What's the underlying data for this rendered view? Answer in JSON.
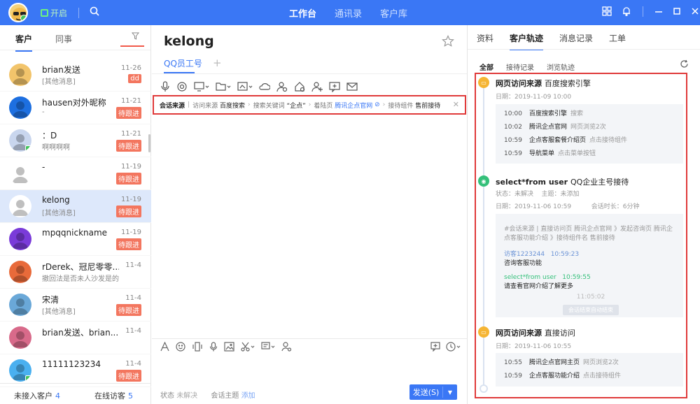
{
  "topbar": {
    "status_label": "开启",
    "tabs": [
      {
        "label": "工作台",
        "active": true
      },
      {
        "label": "通讯录",
        "active": false
      },
      {
        "label": "客户库",
        "active": false
      }
    ],
    "accent": "#3a77f5"
  },
  "left": {
    "tabs": [
      "客户",
      "同事"
    ],
    "contacts": [
      {
        "name": "brian发送",
        "sub": "[其他消息]",
        "date": "11-26",
        "tag": "dd",
        "avatar_color": "#f2c46b",
        "online": false
      },
      {
        "name": "hausen对外昵称",
        "sub": "-",
        "date": "11-21",
        "tag": "待跟进",
        "avatar_color": "#1d6fe0",
        "online": false
      },
      {
        "name": "：D",
        "sub": "啊啊啊啊",
        "date": "11-21",
        "tag": "待跟进",
        "avatar_color": "#c9d6ee",
        "online": true
      },
      {
        "name": "-",
        "sub": "",
        "date": "11-19",
        "tag": "待跟进",
        "avatar_color": "#ffffff",
        "online": false
      },
      {
        "name": "kelong",
        "sub": "[其他消息]",
        "date": "11-19",
        "tag": "待跟进",
        "avatar_color": "#ffffff",
        "online": false,
        "selected": true
      },
      {
        "name": "mpqqnickname",
        "sub": "",
        "date": "11-19",
        "tag": "待跟进",
        "avatar_color": "#7a3bd9",
        "online": false
      },
      {
        "name": "rDerek、冠尼零零...",
        "sub": "撤回法是否未人沙发是的[表情]...",
        "date": "11-4",
        "tag": "",
        "avatar_color": "#e86a3a",
        "online": false
      },
      {
        "name": "宋清",
        "sub": "[其他消息]",
        "date": "11-4",
        "tag": "待跟进",
        "avatar_color": "#6aa8d8",
        "online": false
      },
      {
        "name": "brian发送、brian...",
        "sub": "",
        "date": "11-4",
        "tag": "",
        "avatar_color": "#d86a8a",
        "online": false
      },
      {
        "name": "11111123234",
        "sub": "",
        "date": "11-4",
        "tag": "待跟进",
        "avatar_color": "#4ab0f0",
        "online": true
      }
    ],
    "bottom": {
      "unaccessed_label": "未接入客户",
      "unaccessed_count": "4",
      "online_label": "在线访客",
      "online_count": "5"
    }
  },
  "middle": {
    "title": "kelong",
    "tab": "QQ员工号",
    "chain": {
      "label": "会话来源",
      "source_key": "访问来源",
      "source_val": "百度搜索",
      "kw_key": "搜索关键词",
      "kw_val": "“企点”",
      "page_key": "着陆页",
      "page_val": "腾讯企点官网",
      "comp_key": "接待组件",
      "comp_val": "售前接待"
    },
    "status_label": "状态",
    "status_value": "未解决",
    "topic_label": "会话主题",
    "topic_value": "添加",
    "send_label": "发送(S)"
  },
  "right": {
    "tabs": [
      {
        "label": "资料",
        "active": false
      },
      {
        "label": "客户轨迹",
        "active": true
      },
      {
        "label": "消息记录",
        "active": false
      },
      {
        "label": "工单",
        "active": false
      }
    ],
    "subtabs": [
      {
        "label": "全部",
        "active": true
      },
      {
        "label": "接待记录",
        "active": false
      },
      {
        "label": "浏览轨迹",
        "active": false
      }
    ],
    "events": [
      {
        "title": "网页访问来源",
        "title_note": "百度搜索引擎",
        "date": "日期：2019-11-09   10:00",
        "rows": [
          {
            "time": "10:00",
            "page": "百度搜索引擎",
            "desc": "搜索"
          },
          {
            "time": "10:02",
            "page": "腾讯企点官网",
            "desc": "网页浏览2次"
          },
          {
            "time": "10:59",
            "page": "企点客服套餐介绍页",
            "desc": "点击接待组件"
          },
          {
            "time": "10:59",
            "page": "导航菜单",
            "desc": "点击菜单按钮"
          }
        ]
      },
      {
        "title": "select*from user",
        "title_note": "QQ企业主号接待",
        "state": "状态：未解决",
        "topic": "主题：未添加",
        "date": "日期：2019-11-06   10:59",
        "duration": "会话时长：6分钟",
        "chat": {
          "header": "#会话来源 | 直接访问页 腾讯企点官网 》发起咨询页 腾讯企点客服功能介绍 》接待组件名 售前接待",
          "visitor": "访客1223244",
          "visitor_time": "10:59:23",
          "visitor_msg": "咨询客服功能",
          "agent": "select*from user",
          "agent_time": "10:59:55",
          "agent_msg": "请查看官网介绍了解更多",
          "end_time": "11:05:02",
          "end_label": "会话结束自动结束"
        }
      },
      {
        "title": "网页访问来源",
        "title_note": "直接访问",
        "date": "日期：2019-11-06   10:55",
        "rows": [
          {
            "time": "10:55",
            "page": "腾讯企点官网主页",
            "desc": "网页浏览2次"
          },
          {
            "time": "10:59",
            "page": "企点客服功能介绍",
            "desc": "点击接待组件"
          }
        ]
      }
    ]
  }
}
